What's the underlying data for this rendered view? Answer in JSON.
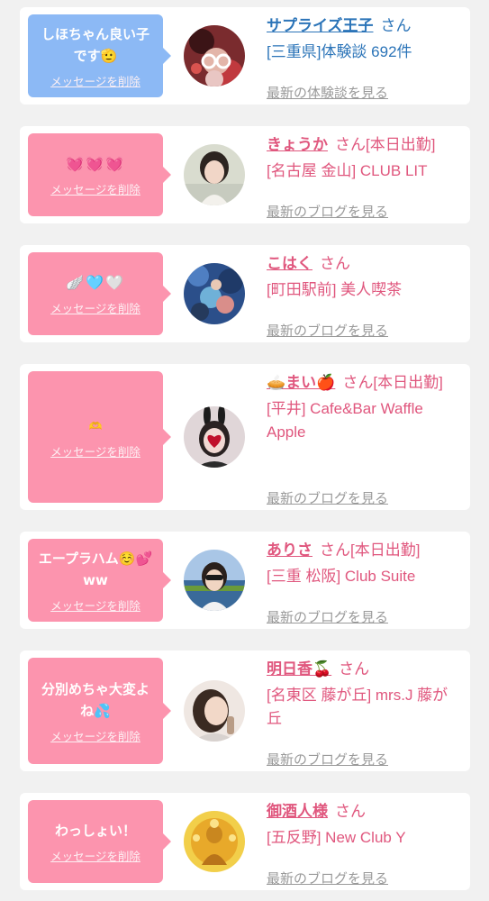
{
  "entries": [
    {
      "message": "しほちゃん良い子です🫡",
      "delete_label": "メッセージを削除",
      "name": "サプライズ王子",
      "suffix": "さん",
      "shop": "[三重県]体験談 692件",
      "link": "最新の体験談を見る",
      "color": "#8cb9f5"
    },
    {
      "message": "💓💓💓",
      "delete_label": "メッセージを削除",
      "name": "きょうか",
      "suffix": "さん[本日出勤]",
      "shop": "[名古屋 金山] CLUB LIT",
      "link": "最新のブログを見る",
      "color": "#fc94ae"
    },
    {
      "message": "🪽🩵🤍",
      "delete_label": "メッセージを削除",
      "name": "こはく",
      "suffix": "さん",
      "shop": "[町田駅前] 美人喫茶",
      "link": "最新のブログを見る",
      "color": "#fc94ae"
    },
    {
      "message": "🫶",
      "delete_label": "メッセージを削除",
      "name": "🥧まい🍎",
      "suffix": "さん[本日出勤]",
      "shop": "[平井] Cafe&Bar Waffle Apple",
      "link": "最新のブログを見る",
      "color": "#fc94ae"
    },
    {
      "message": "エープラハム☺️💕ww",
      "delete_label": "メッセージを削除",
      "name": "ありさ",
      "suffix": "さん[本日出勤]",
      "shop": "[三重 松阪] Club Suite",
      "link": "最新のブログを見る",
      "color": "#fc94ae"
    },
    {
      "message": "分別めちゃ大変よね💦",
      "delete_label": "メッセージを削除",
      "name": "明日香🍒",
      "suffix": "さん",
      "shop": "[名東区 藤が丘] mrs.J 藤が丘",
      "link": "最新のブログを見る",
      "color": "#fc94ae"
    },
    {
      "message": "わっしょい！",
      "delete_label": "メッセージを削除",
      "name": "御酒人様",
      "suffix": "さん",
      "shop": "[五反野] New Club Y",
      "link": "最新のブログを見る",
      "color": "#fc94ae"
    }
  ]
}
